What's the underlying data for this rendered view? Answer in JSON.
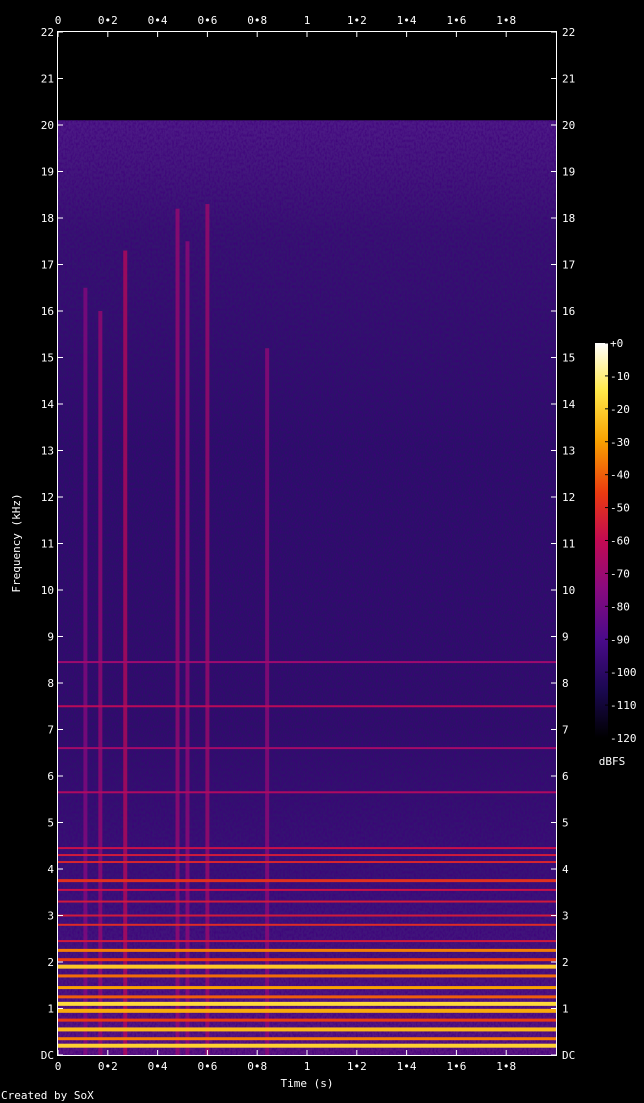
{
  "chart_data": {
    "type": "heatmap",
    "title": "",
    "xlabel": "Time (s)",
    "ylabel": "Frequency (kHz)",
    "xlim": [
      0,
      2.0
    ],
    "ylim": [
      0,
      22
    ],
    "x_ticks": [
      "0",
      "0•2",
      "0•4",
      "0•6",
      "0•8",
      "1",
      "1•2",
      "1•4",
      "1•6",
      "1•8"
    ],
    "y_ticks": [
      "DC",
      "1",
      "2",
      "3",
      "4",
      "5",
      "6",
      "7",
      "8",
      "9",
      "10",
      "11",
      "12",
      "13",
      "14",
      "15",
      "16",
      "17",
      "18",
      "19",
      "20",
      "21",
      "22"
    ],
    "signal_cutoff_khz": 20.1,
    "colorbar": {
      "label": "dBFS",
      "ticks": [
        "+0",
        "-10",
        "-20",
        "-30",
        "-40",
        "-50",
        "-60",
        "-70",
        "-80",
        "-90",
        "-100",
        "-110",
        "-120"
      ],
      "range": [
        -120,
        0
      ],
      "colormap": [
        "#000000",
        "#1a0850",
        "#4a0a8a",
        "#8a0a7e",
        "#c20a52",
        "#ea3a10",
        "#f8a000",
        "#ffe84a",
        "#ffffff"
      ]
    },
    "harmonic_bands_khz": [
      {
        "f": 0.2,
        "db": -20
      },
      {
        "f": 0.35,
        "db": -35
      },
      {
        "f": 0.55,
        "db": -25
      },
      {
        "f": 0.75,
        "db": -45
      },
      {
        "f": 0.95,
        "db": -28
      },
      {
        "f": 1.1,
        "db": -18
      },
      {
        "f": 1.25,
        "db": -40
      },
      {
        "f": 1.45,
        "db": -30
      },
      {
        "f": 1.7,
        "db": -38
      },
      {
        "f": 1.9,
        "db": -22
      },
      {
        "f": 2.05,
        "db": -45
      },
      {
        "f": 2.25,
        "db": -35
      },
      {
        "f": 2.45,
        "db": -55
      },
      {
        "f": 2.8,
        "db": -50
      },
      {
        "f": 3.0,
        "db": -55
      },
      {
        "f": 3.3,
        "db": -55
      },
      {
        "f": 3.55,
        "db": -58
      },
      {
        "f": 3.75,
        "db": -48
      },
      {
        "f": 4.15,
        "db": -52
      },
      {
        "f": 4.3,
        "db": -55
      },
      {
        "f": 4.45,
        "db": -58
      },
      {
        "f": 5.65,
        "db": -65
      },
      {
        "f": 6.6,
        "db": -68
      },
      {
        "f": 7.5,
        "db": -62
      },
      {
        "f": 8.45,
        "db": -70
      }
    ],
    "transient_streaks_s": [
      {
        "t": 0.11,
        "top_khz": 16.5,
        "db": -75
      },
      {
        "t": 0.17,
        "top_khz": 16.0,
        "db": -70
      },
      {
        "t": 0.27,
        "top_khz": 17.3,
        "db": -62
      },
      {
        "t": 0.48,
        "top_khz": 18.2,
        "db": -70
      },
      {
        "t": 0.52,
        "top_khz": 17.5,
        "db": -72
      },
      {
        "t": 0.6,
        "top_khz": 18.3,
        "db": -68
      },
      {
        "t": 0.84,
        "top_khz": 15.2,
        "db": -72
      }
    ]
  },
  "footer": {
    "credit": "Created by SoX"
  }
}
